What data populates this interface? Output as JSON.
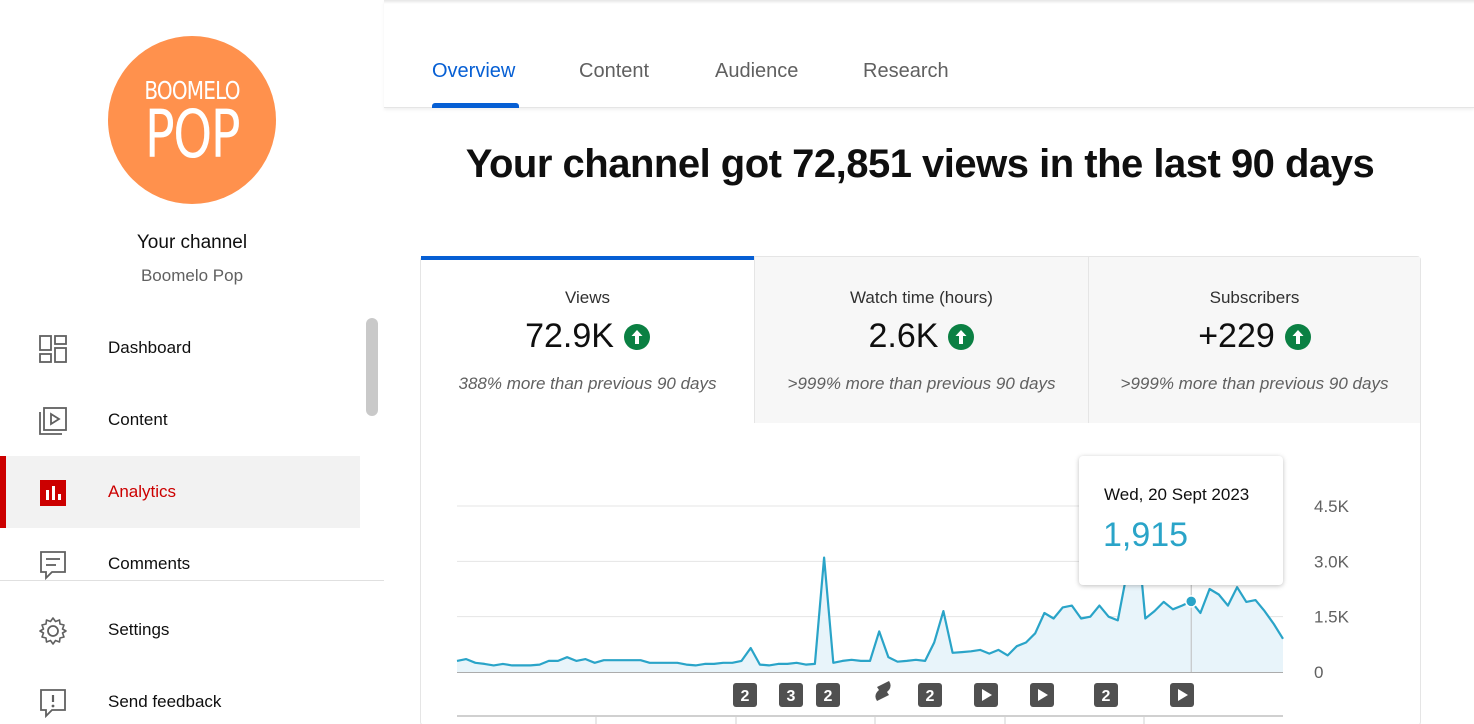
{
  "channel": {
    "logo_line1": "BOOMELO",
    "logo_line2": "POP",
    "logo_color": "#ff914d",
    "title": "Your channel",
    "name": "Boomelo Pop"
  },
  "nav": {
    "items": [
      {
        "label": "Dashboard",
        "icon": "dashboard-icon"
      },
      {
        "label": "Content",
        "icon": "content-icon"
      },
      {
        "label": "Analytics",
        "icon": "analytics-icon",
        "active": true
      },
      {
        "label": "Comments",
        "icon": "comments-icon"
      },
      {
        "label": "Settings",
        "icon": "gear-icon"
      },
      {
        "label": "Send feedback",
        "icon": "feedback-icon"
      }
    ]
  },
  "tabs": [
    {
      "label": "Overview",
      "active": true
    },
    {
      "label": "Content"
    },
    {
      "label": "Audience"
    },
    {
      "label": "Research"
    }
  ],
  "headline": "Your channel got 72,851 views in the last 90 days",
  "metrics": [
    {
      "title": "Views",
      "value": "72.9K",
      "compare": "388% more than previous 90 days",
      "trend": "up"
    },
    {
      "title": "Watch time (hours)",
      "value": "2.6K",
      "compare": ">999% more than previous 90 days",
      "trend": "up"
    },
    {
      "title": "Subscribers",
      "value": "+229",
      "compare": ">999% more than previous 90 days",
      "trend": "up"
    }
  ],
  "tooltip": {
    "date": "Wed, 20 Sept 2023",
    "value": "1,915"
  },
  "colors": {
    "accent": "#065fd4",
    "analytics_red": "#cc0000",
    "trend_up": "#0b8043",
    "line": "#2aa4c8"
  },
  "chart_data": {
    "type": "area",
    "ylim": [
      0,
      4500
    ],
    "y_ticks": [
      "0",
      "1.5K",
      "3.0K",
      "4.5K"
    ],
    "y_tick_values": [
      0,
      1500,
      3000,
      4500
    ],
    "grid": true,
    "series": [
      {
        "values": [
          300,
          350,
          250,
          220,
          180,
          220,
          180,
          180,
          180,
          200,
          300,
          300,
          400,
          300,
          350,
          250,
          320,
          320,
          320,
          320,
          320,
          250,
          250,
          250,
          250,
          200,
          180,
          220,
          220,
          250,
          250,
          300,
          650,
          200,
          180,
          220,
          220,
          250,
          200,
          220,
          3100,
          250,
          300,
          330,
          300,
          300,
          1100,
          400,
          280,
          300,
          330,
          300,
          800,
          1650,
          520,
          540,
          560,
          600,
          500,
          600,
          450,
          700,
          800,
          1050,
          1600,
          1450,
          1750,
          1800,
          1450,
          1500,
          1800,
          1500,
          1400,
          2700,
          4100,
          1450,
          1650,
          1900,
          1700,
          1800,
          1915,
          1600,
          2250,
          2100,
          1800,
          2300,
          1900,
          1950,
          1650,
          1300,
          900
        ]
      }
    ],
    "annotation_markers": [
      "2",
      "3",
      "2",
      "shorts-icon",
      "2",
      "play-icon",
      "play-icon",
      "2",
      "play-icon"
    ],
    "highlight": {
      "date": "Wed, 20 Sept 2023",
      "value": 1915
    }
  }
}
